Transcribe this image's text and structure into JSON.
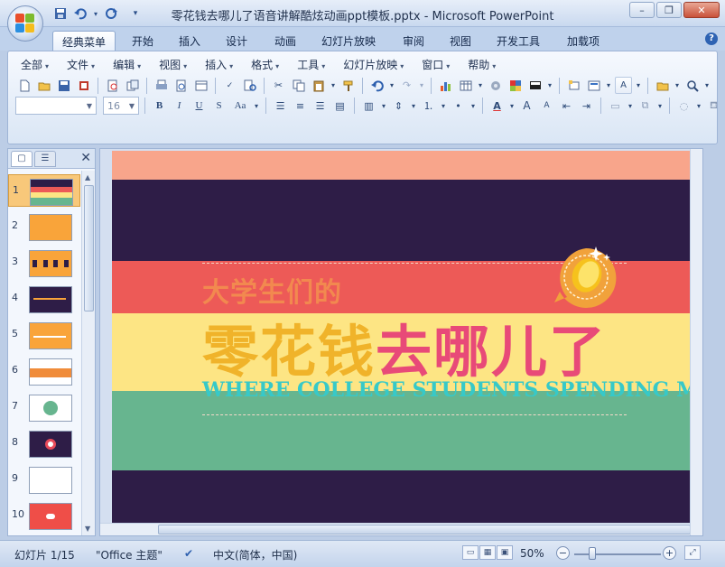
{
  "window": {
    "title": "零花钱去哪儿了语音讲解酷炫动画ppt模板.pptx - Microsoft PowerPoint",
    "minimize": "–",
    "restore": "❐",
    "close": "✕"
  },
  "quick_access": {
    "save_icon": "floppy-icon",
    "undo_icon": "undo-icon",
    "redo_icon": "redo-icon",
    "customize_icon": "dropdown-icon"
  },
  "ribbon_tabs": [
    "经典菜单",
    "开始",
    "插入",
    "设计",
    "动画",
    "幻灯片放映",
    "审阅",
    "视图",
    "开发工具",
    "加载项"
  ],
  "active_tab_index": 0,
  "menu_bar": [
    "全部",
    "文件",
    "编辑",
    "视图",
    "插入",
    "格式",
    "工具",
    "幻灯片放映",
    "窗口",
    "帮助"
  ],
  "format_toolbar": {
    "font_name": "",
    "font_size": "16",
    "bold": "B",
    "italic": "I",
    "underline": "U",
    "strike": "S",
    "change_case": "Aa"
  },
  "slide_pane": {
    "numbers": [
      "1",
      "2",
      "3",
      "4",
      "5",
      "6",
      "7",
      "8",
      "9",
      "10"
    ],
    "selected_index": 0
  },
  "slide": {
    "small_title": "大学生们的",
    "big_title_part1": "零花钱",
    "big_title_highlight": "去",
    "big_title_part2": "哪儿了",
    "subtitle": "WHERE COLLEGE STUDENTS SPENDING MONEY GO",
    "colors": {
      "salmon": "#f8a58b",
      "navy": "#2e1d47",
      "red": "#ed5a57",
      "yellow": "#fde584",
      "green": "#67b58f",
      "orange_text": "#f2894f",
      "gold_text": "#f0b32a",
      "pink_text": "#e84a78",
      "teal_text": "#37c9c8"
    }
  },
  "status_bar": {
    "slide_info": "幻灯片 1/15",
    "theme": "\"Office 主题\"",
    "language": "中文(简体，中国)",
    "zoom": "50%"
  }
}
